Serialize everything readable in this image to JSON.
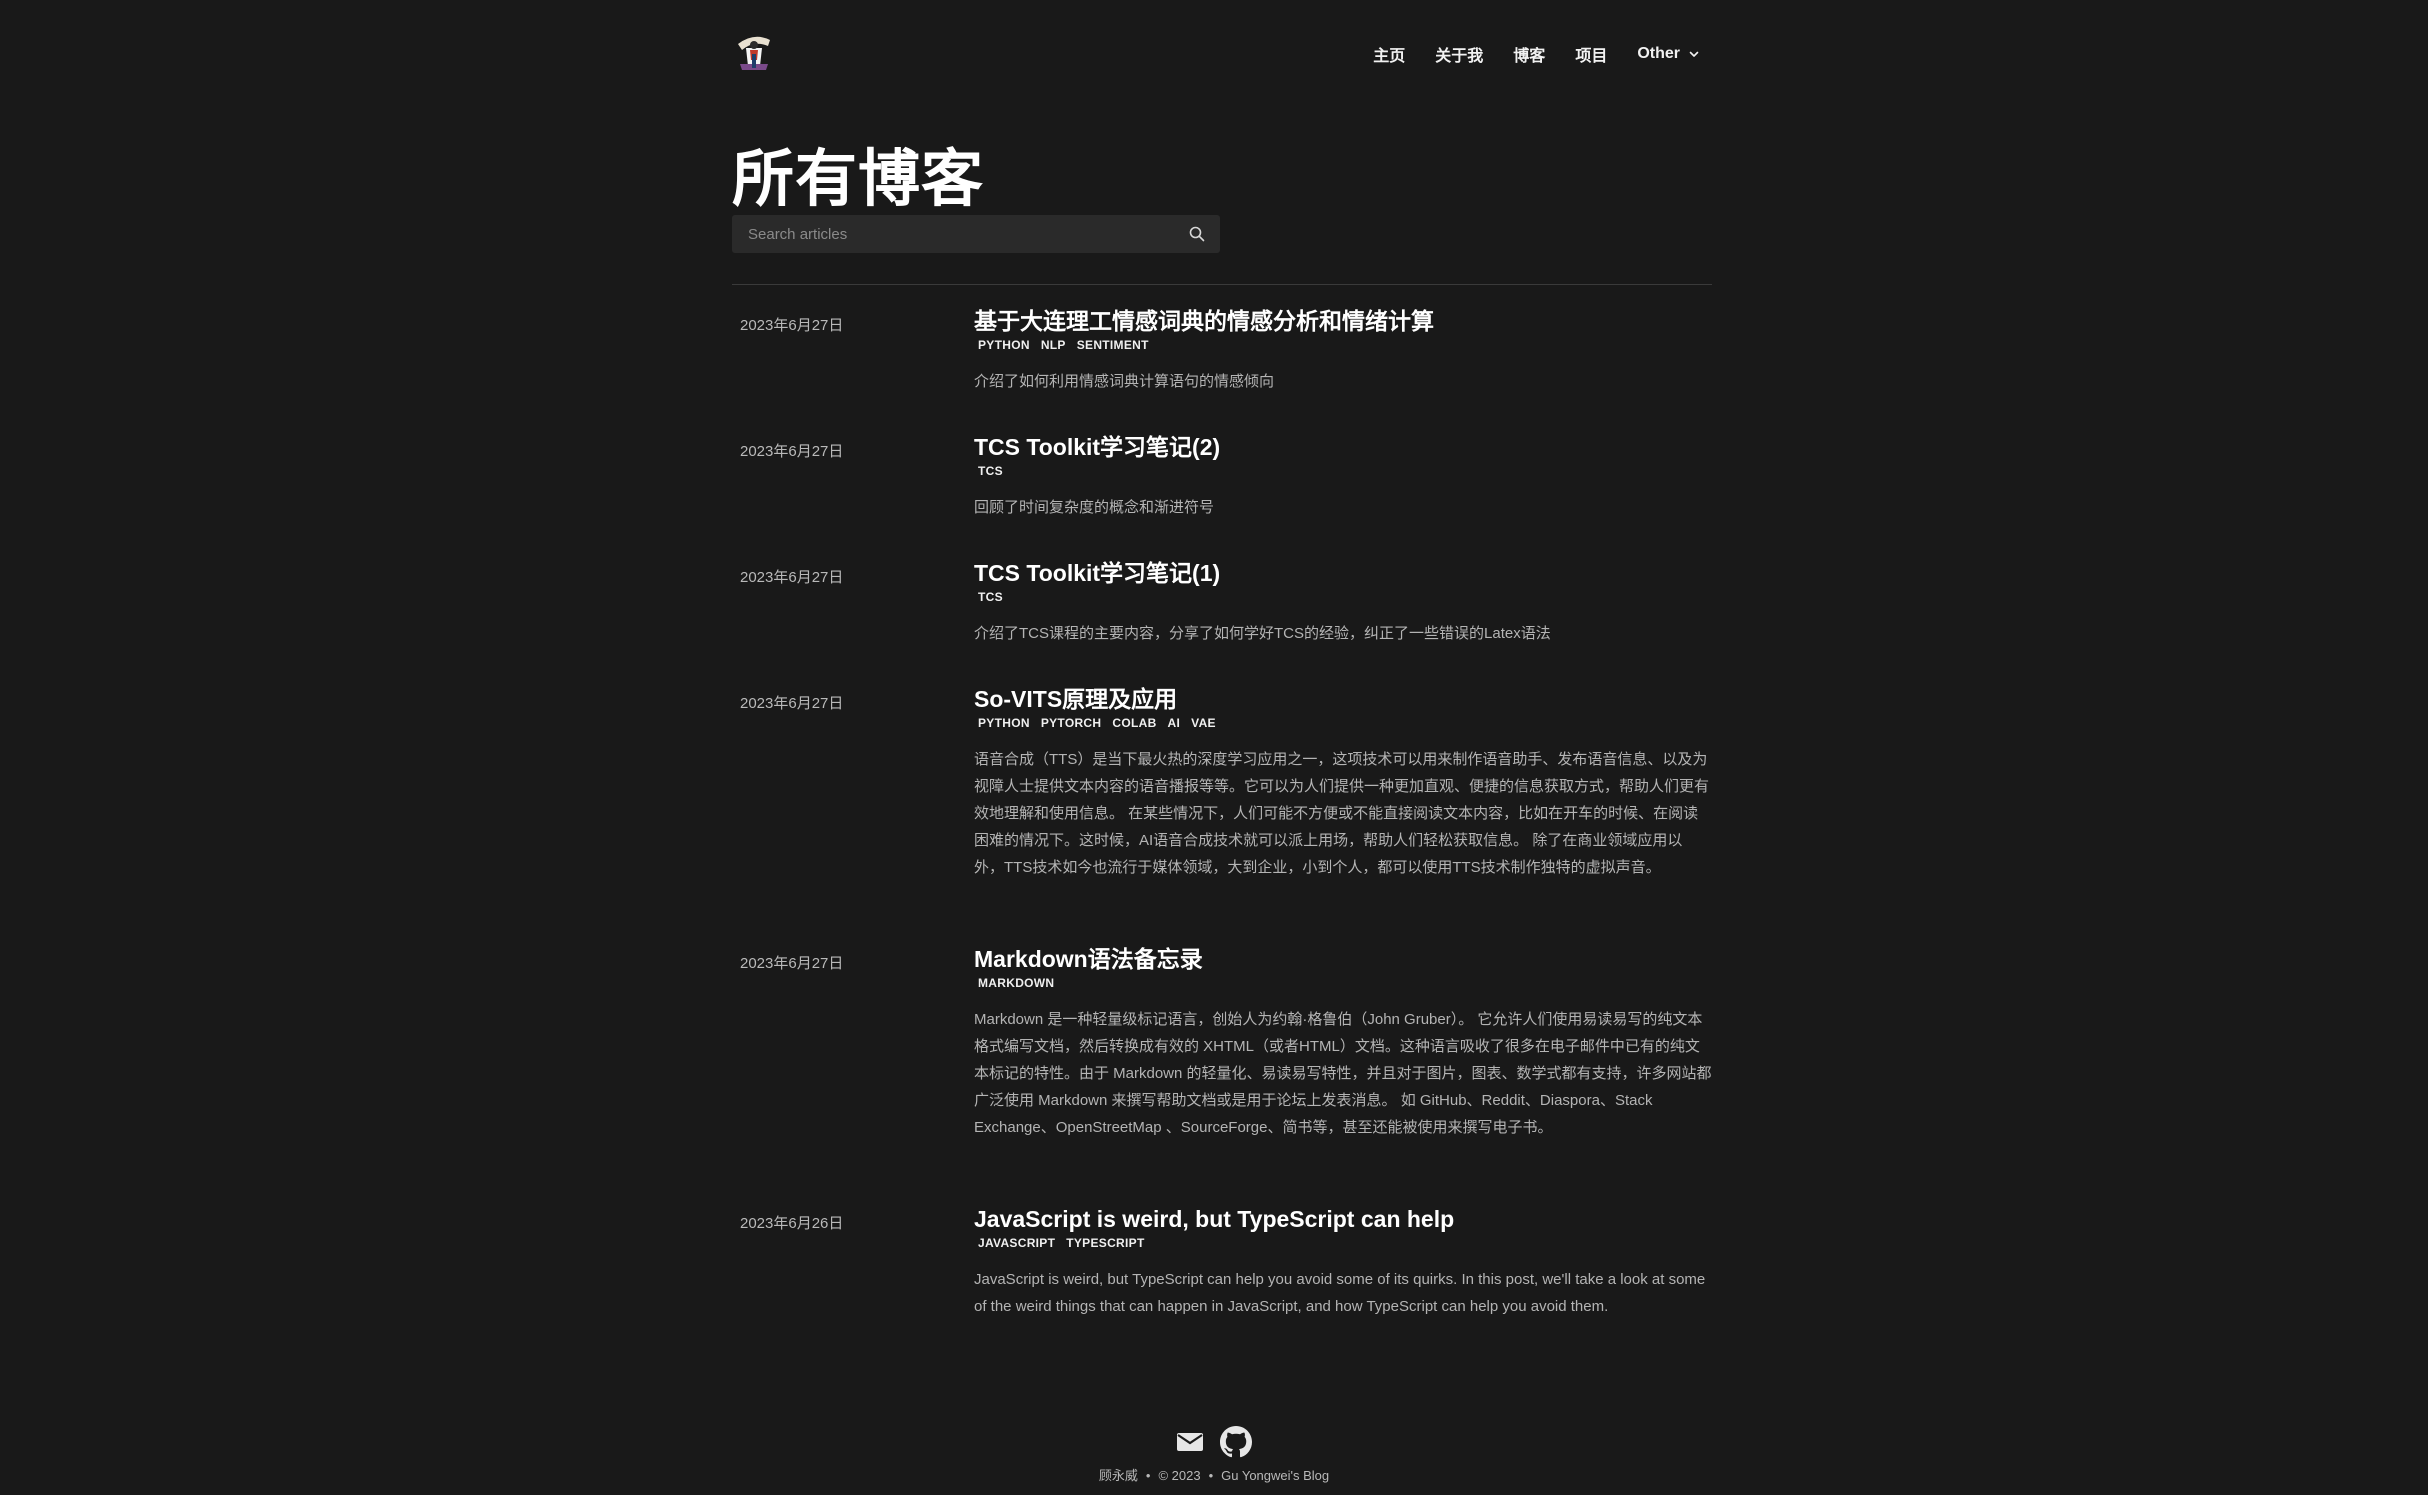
{
  "nav": {
    "items": [
      "主页",
      "关于我",
      "博客",
      "项目"
    ],
    "other_label": "Other"
  },
  "page": {
    "title": "所有博客"
  },
  "search": {
    "placeholder": "Search articles"
  },
  "posts": [
    {
      "date": "2023年6月27日",
      "title": "基于大连理工情感词典的情感分析和情绪计算",
      "tags": [
        "PYTHON",
        "NLP",
        "SENTIMENT"
      ],
      "description": "介绍了如何利用情感词典计算语句的情感倾向"
    },
    {
      "date": "2023年6月27日",
      "title": "TCS Toolkit学习笔记(2)",
      "tags": [
        "TCS"
      ],
      "description": "回顾了时间复杂度的概念和渐进符号"
    },
    {
      "date": "2023年6月27日",
      "title": "TCS Toolkit学习笔记(1)",
      "tags": [
        "TCS"
      ],
      "description": "介绍了TCS课程的主要内容，分享了如何学好TCS的经验，纠正了一些错误的Latex语法"
    },
    {
      "date": "2023年6月27日",
      "title": "So-VITS原理及应用",
      "tags": [
        "PYTHON",
        "PYTORCH",
        "COLAB",
        "AI",
        "VAE"
      ],
      "description": "语音合成（TTS）是当下最火热的深度学习应用之一，这项技术可以用来制作语音助手、发布语音信息、以及为视障人士提供文本内容的语音播报等等。它可以为人们提供一种更加直观、便捷的信息获取方式，帮助人们更有效地理解和使用信息。 在某些情况下，人们可能不方便或不能直接阅读文本内容，比如在开车的时候、在阅读困难的情况下。这时候，AI语音合成技术就可以派上用场，帮助人们轻松获取信息。 除了在商业领域应用以外，TTS技术如今也流行于媒体领域，大到企业，小到个人，都可以使用TTS技术制作独特的虚拟声音。"
    },
    {
      "date": "2023年6月27日",
      "title": "Markdown语法备忘录",
      "tags": [
        "MARKDOWN"
      ],
      "description": "Markdown 是一种轻量级标记语言，创始人为约翰·格鲁伯（John Gruber）。 它允许人们使用易读易写的纯文本格式编写文档，然后转换成有效的 XHTML（或者HTML）文档。这种语言吸收了很多在电子邮件中已有的纯文本标记的特性。由于 Markdown 的轻量化、易读易写特性，并且对于图片，图表、数学式都有支持，许多网站都广泛使用 Markdown 来撰写帮助文档或是用于论坛上发表消息。 如 GitHub、Reddit、Diaspora、Stack Exchange、OpenStreetMap 、SourceForge、简书等，甚至还能被使用来撰写电子书。"
    },
    {
      "date": "2023年6月26日",
      "title": "JavaScript is weird, but TypeScript can help",
      "tags": [
        "JAVASCRIPT",
        "TYPESCRIPT"
      ],
      "description": "JavaScript is weird, but TypeScript can help you avoid some of its quirks. In this post, we'll take a look at some of the weird things that can happen in JavaScript, and how TypeScript can help you avoid them."
    }
  ],
  "footer": {
    "author": "顾永威",
    "sep": "•",
    "copyright": "© 2023",
    "blog_name": "Gu Yongwei's Blog",
    "icons": [
      "mail-icon",
      "github-icon"
    ]
  }
}
